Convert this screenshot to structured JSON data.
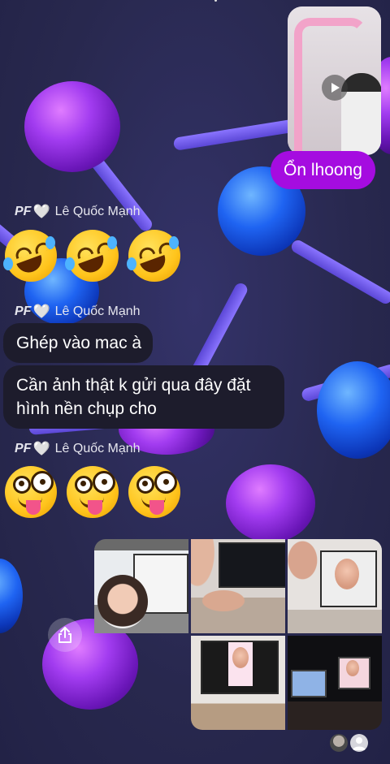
{
  "chat": {
    "top_reply": {
      "text": "Ổn lhoong"
    },
    "groups": [
      {
        "sender_prefix": "PF",
        "sender_heart": "🤍",
        "sender_name": "Lê Quốc Mạnh",
        "emojis": [
          "🤣",
          "🤣",
          "🤣"
        ]
      },
      {
        "sender_prefix": "PF",
        "sender_heart": "🤍",
        "sender_name": "Lê Quốc Mạnh",
        "messages": [
          "Ghép vào mac à",
          "Cần ảnh thật k gửi qua đây đặt hình nền chụp cho"
        ]
      },
      {
        "sender_prefix": "PF",
        "sender_heart": "🤍",
        "sender_name": "Lê Quốc Mạnh",
        "emojis": [
          "🤪",
          "🤪",
          "🤪"
        ]
      }
    ]
  },
  "icons": {
    "play": "play-icon",
    "share": "share-icon",
    "seen_avatar_1": "avatar-photo",
    "seen_avatar_2": "default-avatar-icon"
  },
  "colors": {
    "outgoing_bubble": "#a50ce0",
    "incoming_bubble": "#1d1c2c",
    "background": "#2b2a52"
  }
}
